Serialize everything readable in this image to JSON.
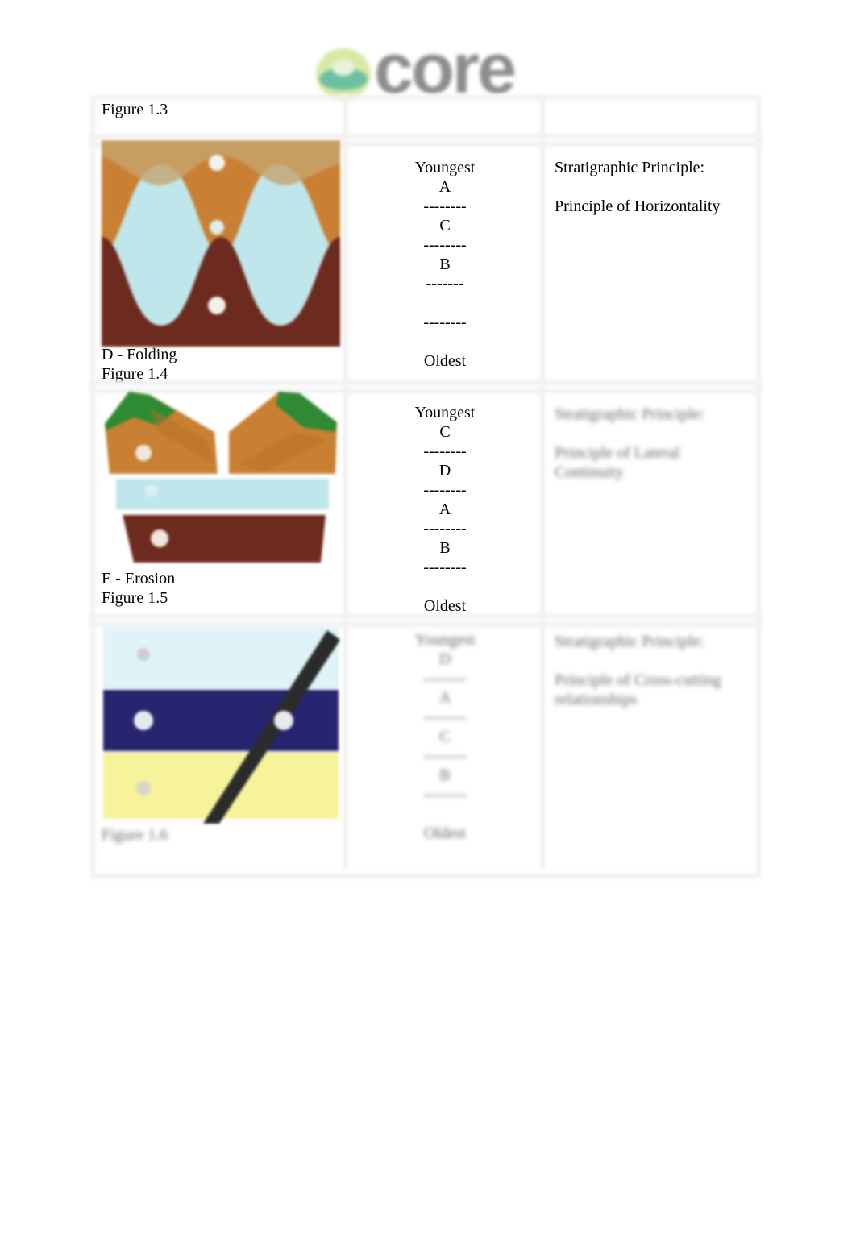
{
  "header": {
    "logo_text": "core",
    "logo_icon": "core-globe-logo-icon"
  },
  "table": {
    "header_row": {
      "figure_label": "Figure 1.3"
    },
    "rows": [
      {
        "diagram": "folding-diagram",
        "caption": "D - Folding",
        "next_figure_label": "Figure 1.4",
        "sequence": [
          "Youngest",
          "A",
          "--------",
          "C",
          "--------",
          "B",
          "-------",
          "",
          "--------",
          "",
          "Oldest"
        ],
        "principle_heading": "Stratigraphic Principle:",
        "principle_name": "Principle of Horizontality",
        "blurred": false
      },
      {
        "diagram": "erosion-diagram",
        "caption": "E - Erosion",
        "next_figure_label": "Figure 1.5",
        "sequence": [
          "Youngest",
          "C",
          "--------",
          "D",
          "--------",
          "A",
          "--------",
          "B",
          "--------",
          "",
          "Oldest"
        ],
        "principle_heading": "Stratigraphic Principle:",
        "principle_name": "Principle of Lateral Continuity",
        "blurred": true
      },
      {
        "diagram": "cross-cutting-diagram",
        "caption": "Figure 1.6",
        "sequence": [
          "Youngest",
          "D",
          "--------",
          "A",
          "--------",
          "C",
          "--------",
          "B",
          "--------",
          "",
          "Oldest"
        ],
        "principle_heading": "Stratigraphic Principle:",
        "principle_name": "Principle of Cross-cutting relationships",
        "blurred": true
      }
    ]
  },
  "colors": {
    "orange": "#c98032",
    "tan": "#c7a46e",
    "light_blue": "#bfe6ea",
    "dark_red": "#6d2a1e",
    "green": "#2f8a34",
    "pale_blue": "#dff3f8",
    "navy": "#27256f",
    "yellow": "#f6f39a",
    "dike": "#2b2b2b"
  }
}
